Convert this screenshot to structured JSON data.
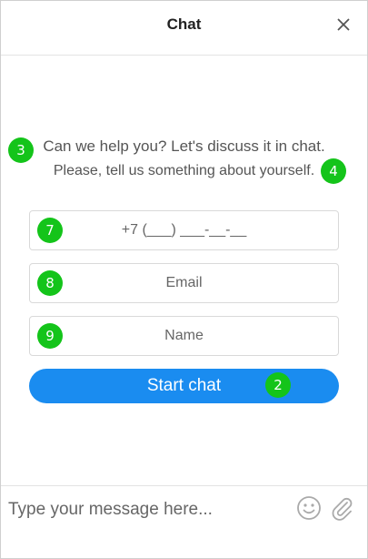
{
  "header": {
    "title": "Chat",
    "close_icon": "close-icon"
  },
  "intro": {
    "line1": "Can we help you? Let's discuss it in chat.",
    "line2": "Please, tell us something about yourself."
  },
  "form": {
    "phone_placeholder": "+7 (___) ___-__-__",
    "email_placeholder": "Email",
    "name_placeholder": "Name",
    "start_label": "Start chat"
  },
  "badges": {
    "start": "2",
    "line1": "3",
    "line2": "4",
    "phone": "7",
    "email": "8",
    "name": "9"
  },
  "footer": {
    "message_placeholder": "Type your message here...",
    "emoji_icon": "smiley-icon",
    "attach_icon": "paperclip-icon"
  },
  "colors": {
    "accent": "#1a8cf0",
    "badge": "#14c41a"
  }
}
